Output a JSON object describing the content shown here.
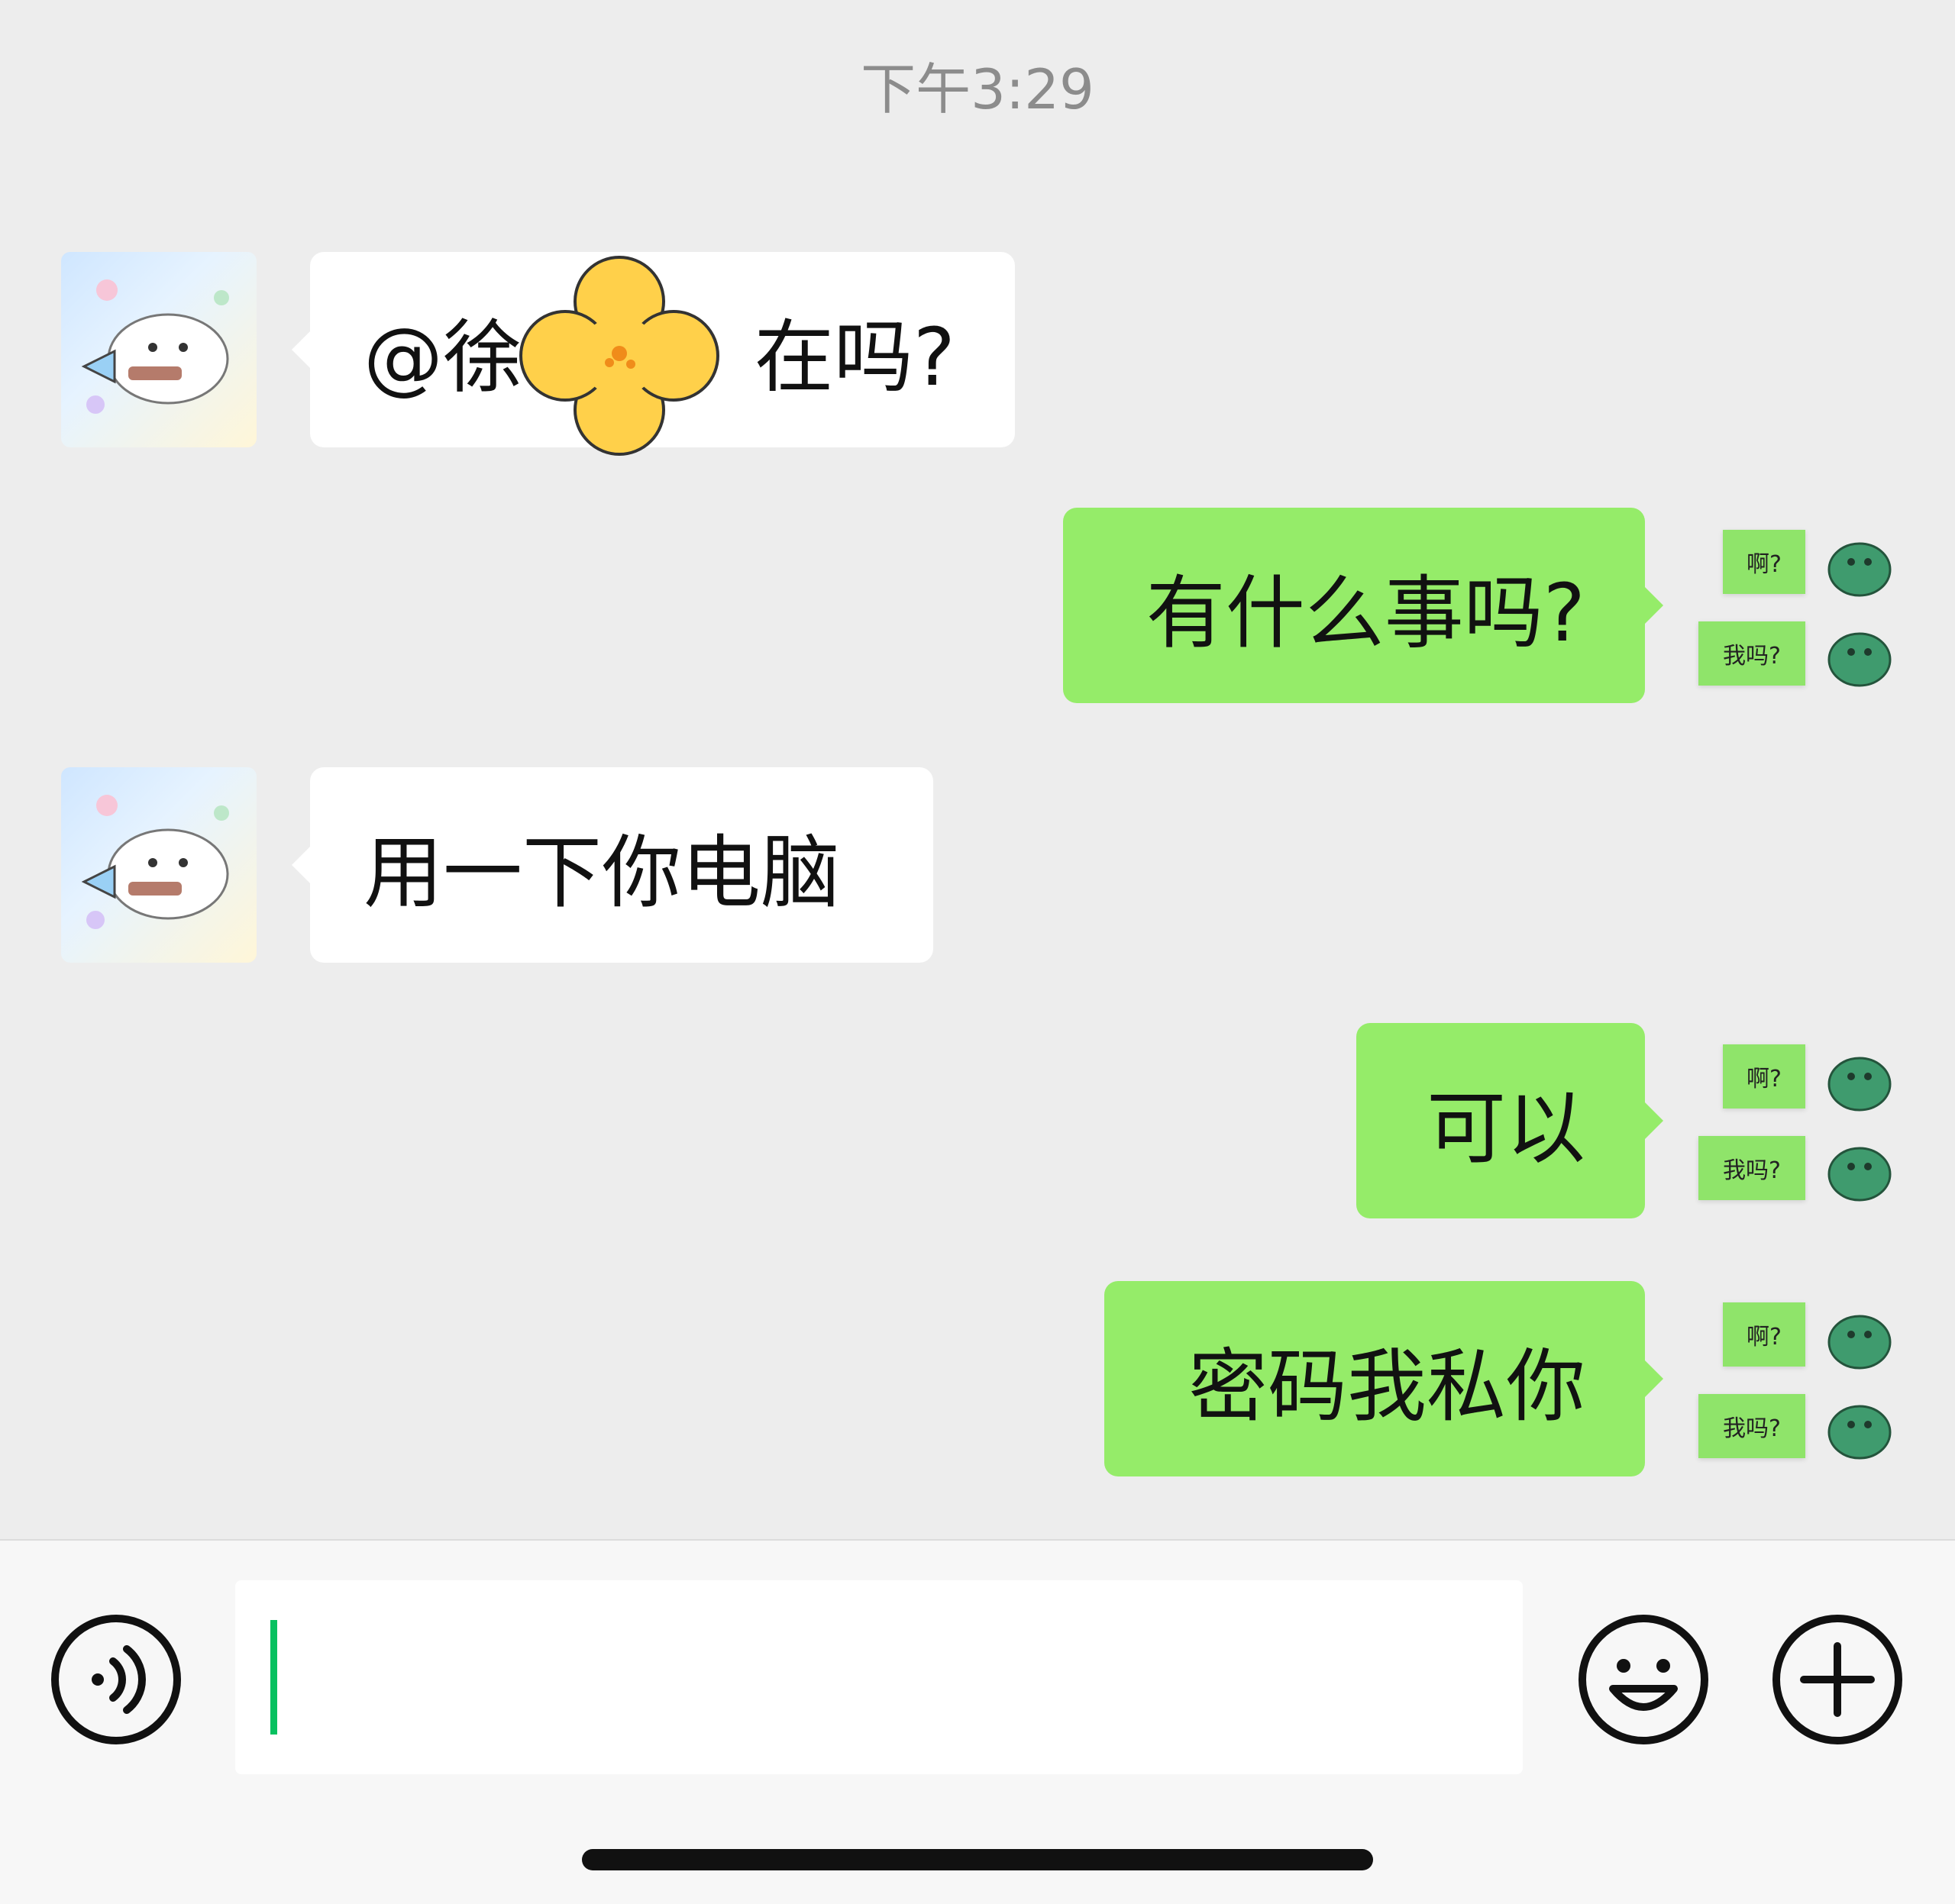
{
  "chat": {
    "timestamp": "下午3:29",
    "messages": [
      {
        "side": "incoming",
        "text_before": "@徐",
        "text_after": "在吗?"
      },
      {
        "side": "outgoing",
        "text": "有什么事吗?"
      },
      {
        "side": "incoming",
        "text": "用一下你电脑"
      },
      {
        "side": "outgoing",
        "text": "可以"
      },
      {
        "side": "outgoing",
        "text": "密码我私你"
      }
    ],
    "sticker_labels": {
      "top": "啊?",
      "bottom": "我吗?"
    }
  },
  "input_bar": {
    "voice_icon": "voice-icon",
    "emoji_icon": "emoji-icon",
    "plus_icon": "plus-icon",
    "input_value": ""
  },
  "colors": {
    "background": "#ededed",
    "incoming_bubble": "#ffffff",
    "outgoing_bubble": "#95ec69",
    "caret": "#07c160"
  }
}
